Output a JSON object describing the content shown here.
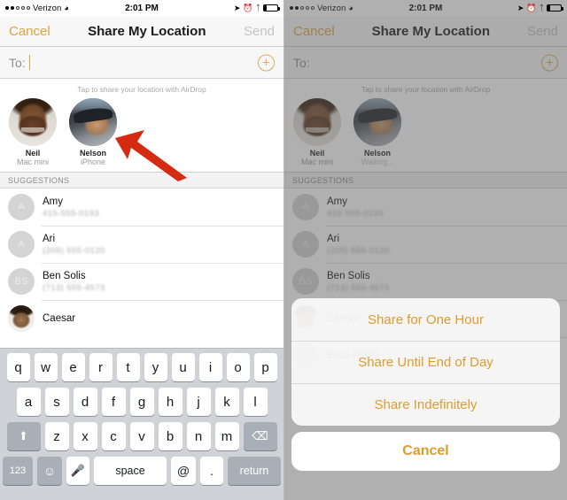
{
  "status_bar": {
    "carrier": "Verizon",
    "time": "2:01 PM",
    "signal_filled": 2,
    "signal_hollow": 3,
    "wifi_icon": "wifi-icon",
    "location_icon": "location-arrow-icon",
    "alarm_icon": "alarm-clock-icon",
    "bluetooth_icon": "bluetooth-icon",
    "battery_icon": "battery-icon"
  },
  "nav": {
    "cancel_label": "Cancel",
    "title": "Share My Location",
    "send_label": "Send"
  },
  "to_field": {
    "label": "To:",
    "value": "",
    "add_contact_icon": "plus-circle-icon"
  },
  "airdrop": {
    "hint": "Tap to share your location with AirDrop",
    "contacts_left": [
      {
        "name": "Neil",
        "subtitle": "Mac mini",
        "avatar": "face-neil"
      },
      {
        "name": "Nelson",
        "subtitle": "iPhone",
        "avatar": "face-nelson"
      }
    ],
    "contacts_right": [
      {
        "name": "Neil",
        "subtitle": "Mac mini",
        "avatar": "face-neil"
      },
      {
        "name": "Nelson",
        "subtitle": "Waiting...",
        "avatar": "face-nelson"
      }
    ]
  },
  "suggestions": {
    "header": "SUGGESTIONS",
    "rows": [
      {
        "initials": "A",
        "name": "Amy",
        "number": "415-555-0193",
        "photo": ""
      },
      {
        "initials": "A",
        "name": "Ari",
        "number": "(209) 555-0120",
        "photo": ""
      },
      {
        "initials": "BS",
        "name": "Ben Solis",
        "number": "(713) 555-4573",
        "photo": ""
      },
      {
        "initials": "",
        "name": "Caesar",
        "number": "",
        "photo": "face-caesar"
      }
    ],
    "behind_sheet_row": {
      "initials": "EP",
      "name": "Erica Perez",
      "number": ""
    }
  },
  "keyboard": {
    "row1": [
      "q",
      "w",
      "e",
      "r",
      "t",
      "y",
      "u",
      "i",
      "o",
      "p"
    ],
    "row2": [
      "a",
      "s",
      "d",
      "f",
      "g",
      "h",
      "j",
      "k",
      "l"
    ],
    "row3": [
      "z",
      "x",
      "c",
      "v",
      "b",
      "n",
      "m"
    ],
    "shift_icon": "shift-arrow-icon",
    "backspace_icon": "backspace-icon",
    "numbers_label": "123",
    "emoji_icon": "emoji-smiley-icon",
    "dictation_icon": "microphone-icon",
    "space_label": "space",
    "at_label": "@",
    "period_label": ".",
    "return_label": "return"
  },
  "action_sheet": {
    "options": [
      "Share for One Hour",
      "Share Until End of Day",
      "Share Indefinitely"
    ],
    "cancel_label": "Cancel"
  },
  "annotations": {
    "arrow_left_target": "Nelson AirDrop contact",
    "arrow_right_target": "Share Indefinitely",
    "arrow_color": "#d52b12"
  }
}
